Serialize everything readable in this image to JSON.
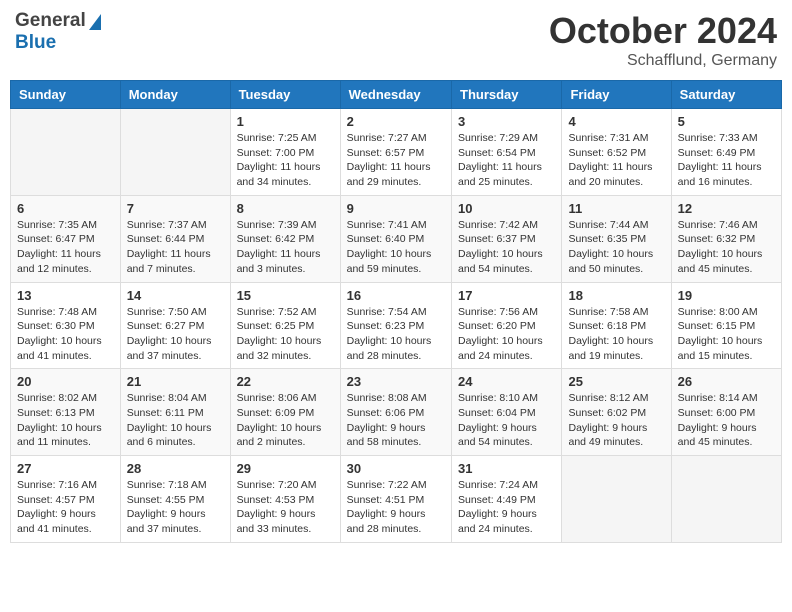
{
  "header": {
    "logo_general": "General",
    "logo_blue": "Blue",
    "month": "October 2024",
    "location": "Schafflund, Germany"
  },
  "weekdays": [
    "Sunday",
    "Monday",
    "Tuesday",
    "Wednesday",
    "Thursday",
    "Friday",
    "Saturday"
  ],
  "weeks": [
    [
      {
        "day": "",
        "info": ""
      },
      {
        "day": "",
        "info": ""
      },
      {
        "day": "1",
        "info": "Sunrise: 7:25 AM\nSunset: 7:00 PM\nDaylight: 11 hours\nand 34 minutes."
      },
      {
        "day": "2",
        "info": "Sunrise: 7:27 AM\nSunset: 6:57 PM\nDaylight: 11 hours\nand 29 minutes."
      },
      {
        "day": "3",
        "info": "Sunrise: 7:29 AM\nSunset: 6:54 PM\nDaylight: 11 hours\nand 25 minutes."
      },
      {
        "day": "4",
        "info": "Sunrise: 7:31 AM\nSunset: 6:52 PM\nDaylight: 11 hours\nand 20 minutes."
      },
      {
        "day": "5",
        "info": "Sunrise: 7:33 AM\nSunset: 6:49 PM\nDaylight: 11 hours\nand 16 minutes."
      }
    ],
    [
      {
        "day": "6",
        "info": "Sunrise: 7:35 AM\nSunset: 6:47 PM\nDaylight: 11 hours\nand 12 minutes."
      },
      {
        "day": "7",
        "info": "Sunrise: 7:37 AM\nSunset: 6:44 PM\nDaylight: 11 hours\nand 7 minutes."
      },
      {
        "day": "8",
        "info": "Sunrise: 7:39 AM\nSunset: 6:42 PM\nDaylight: 11 hours\nand 3 minutes."
      },
      {
        "day": "9",
        "info": "Sunrise: 7:41 AM\nSunset: 6:40 PM\nDaylight: 10 hours\nand 59 minutes."
      },
      {
        "day": "10",
        "info": "Sunrise: 7:42 AM\nSunset: 6:37 PM\nDaylight: 10 hours\nand 54 minutes."
      },
      {
        "day": "11",
        "info": "Sunrise: 7:44 AM\nSunset: 6:35 PM\nDaylight: 10 hours\nand 50 minutes."
      },
      {
        "day": "12",
        "info": "Sunrise: 7:46 AM\nSunset: 6:32 PM\nDaylight: 10 hours\nand 45 minutes."
      }
    ],
    [
      {
        "day": "13",
        "info": "Sunrise: 7:48 AM\nSunset: 6:30 PM\nDaylight: 10 hours\nand 41 minutes."
      },
      {
        "day": "14",
        "info": "Sunrise: 7:50 AM\nSunset: 6:27 PM\nDaylight: 10 hours\nand 37 minutes."
      },
      {
        "day": "15",
        "info": "Sunrise: 7:52 AM\nSunset: 6:25 PM\nDaylight: 10 hours\nand 32 minutes."
      },
      {
        "day": "16",
        "info": "Sunrise: 7:54 AM\nSunset: 6:23 PM\nDaylight: 10 hours\nand 28 minutes."
      },
      {
        "day": "17",
        "info": "Sunrise: 7:56 AM\nSunset: 6:20 PM\nDaylight: 10 hours\nand 24 minutes."
      },
      {
        "day": "18",
        "info": "Sunrise: 7:58 AM\nSunset: 6:18 PM\nDaylight: 10 hours\nand 19 minutes."
      },
      {
        "day": "19",
        "info": "Sunrise: 8:00 AM\nSunset: 6:15 PM\nDaylight: 10 hours\nand 15 minutes."
      }
    ],
    [
      {
        "day": "20",
        "info": "Sunrise: 8:02 AM\nSunset: 6:13 PM\nDaylight: 10 hours\nand 11 minutes."
      },
      {
        "day": "21",
        "info": "Sunrise: 8:04 AM\nSunset: 6:11 PM\nDaylight: 10 hours\nand 6 minutes."
      },
      {
        "day": "22",
        "info": "Sunrise: 8:06 AM\nSunset: 6:09 PM\nDaylight: 10 hours\nand 2 minutes."
      },
      {
        "day": "23",
        "info": "Sunrise: 8:08 AM\nSunset: 6:06 PM\nDaylight: 9 hours\nand 58 minutes."
      },
      {
        "day": "24",
        "info": "Sunrise: 8:10 AM\nSunset: 6:04 PM\nDaylight: 9 hours\nand 54 minutes."
      },
      {
        "day": "25",
        "info": "Sunrise: 8:12 AM\nSunset: 6:02 PM\nDaylight: 9 hours\nand 49 minutes."
      },
      {
        "day": "26",
        "info": "Sunrise: 8:14 AM\nSunset: 6:00 PM\nDaylight: 9 hours\nand 45 minutes."
      }
    ],
    [
      {
        "day": "27",
        "info": "Sunrise: 7:16 AM\nSunset: 4:57 PM\nDaylight: 9 hours\nand 41 minutes."
      },
      {
        "day": "28",
        "info": "Sunrise: 7:18 AM\nSunset: 4:55 PM\nDaylight: 9 hours\nand 37 minutes."
      },
      {
        "day": "29",
        "info": "Sunrise: 7:20 AM\nSunset: 4:53 PM\nDaylight: 9 hours\nand 33 minutes."
      },
      {
        "day": "30",
        "info": "Sunrise: 7:22 AM\nSunset: 4:51 PM\nDaylight: 9 hours\nand 28 minutes."
      },
      {
        "day": "31",
        "info": "Sunrise: 7:24 AM\nSunset: 4:49 PM\nDaylight: 9 hours\nand 24 minutes."
      },
      {
        "day": "",
        "info": ""
      },
      {
        "day": "",
        "info": ""
      }
    ]
  ]
}
